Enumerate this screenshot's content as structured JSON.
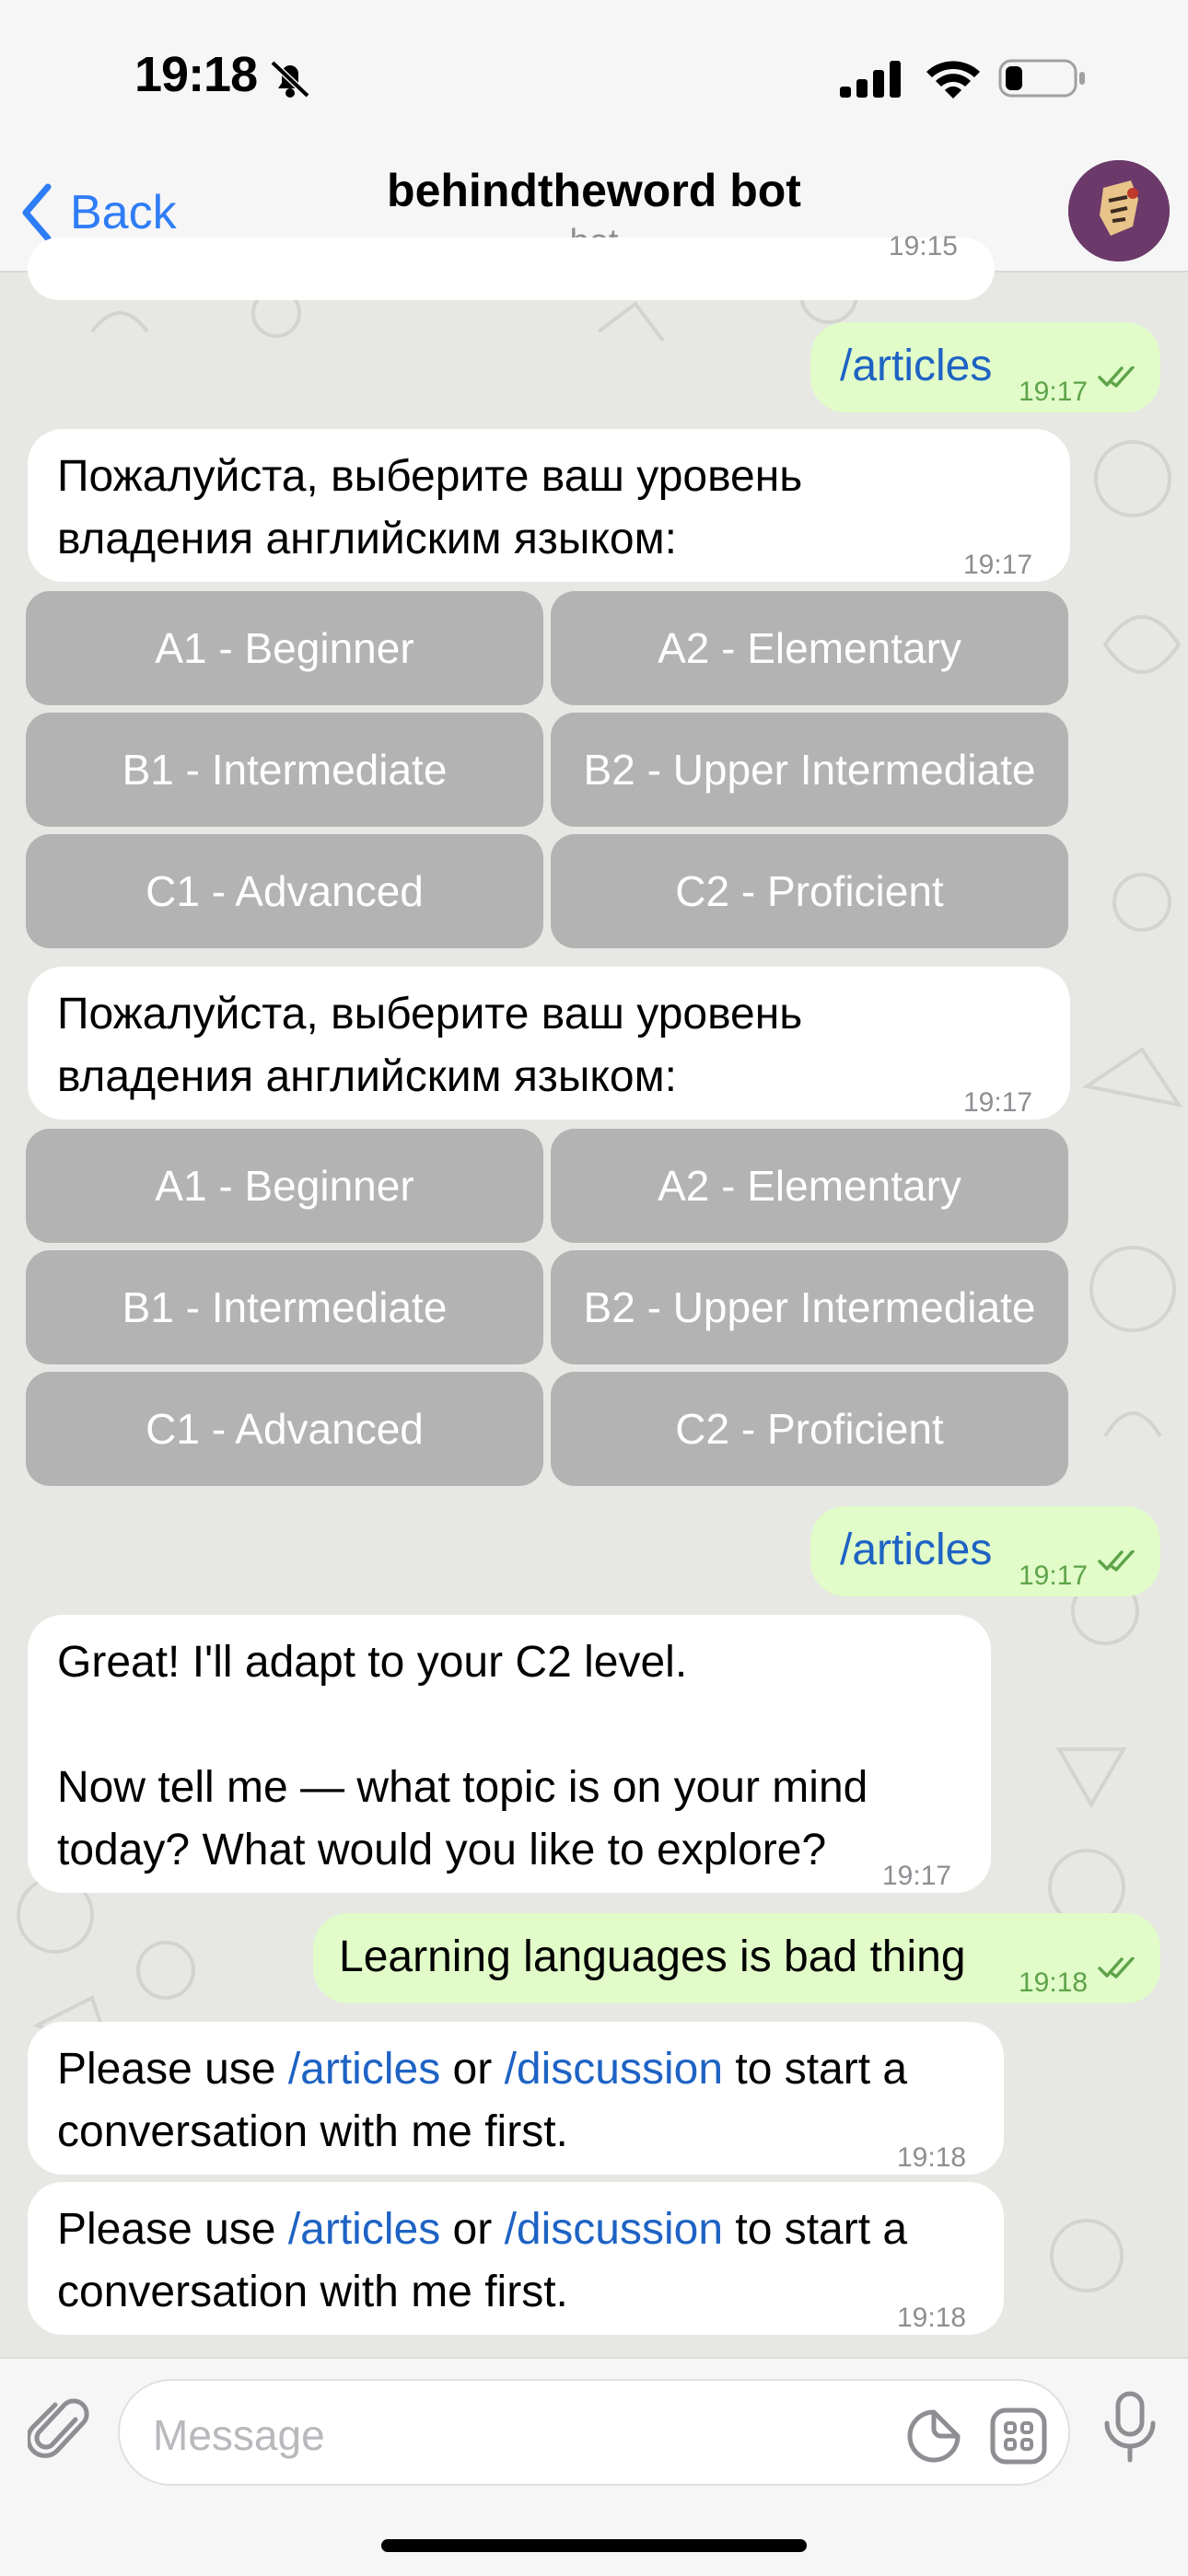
{
  "status_bar": {
    "time": "19:18"
  },
  "header": {
    "back_label": "Back",
    "title": "behindtheword bot",
    "subtitle": "bot"
  },
  "chat": {
    "partial_time": "19:15",
    "msg1": {
      "text": "/articles",
      "time": "19:17"
    },
    "msg2": {
      "line1": "Пожалуйста, выберите ваш уровень",
      "line2": "владения английским языком:",
      "time": "19:17"
    },
    "keyboard1": [
      "A1 - Beginner",
      "A2 - Elementary",
      "B1 - Intermediate",
      "B2 - Upper Intermediate",
      "C1 - Advanced",
      "C2 - Proficient"
    ],
    "msg3": {
      "line1": "Пожалуйста, выберите ваш уровень",
      "line2": "владения английским языком:",
      "time": "19:17"
    },
    "keyboard2": [
      "A1 - Beginner",
      "A2 - Elementary",
      "B1 - Intermediate",
      "B2 - Upper Intermediate",
      "C1 - Advanced",
      "C2 - Proficient"
    ],
    "msg4": {
      "text": "/articles",
      "time": "19:17"
    },
    "msg5": {
      "line1": "Great! I'll adapt to your C2 level.",
      "line2": "Now tell me — what topic is on your mind",
      "line3": "today? What would you like to explore?",
      "time": "19:17"
    },
    "msg6": {
      "text": "Learning languages is bad thing",
      "time": "19:18"
    },
    "msg7": {
      "pre": "Please use ",
      "cmd1": "/articles",
      "mid": " or ",
      "cmd2": "/discussion",
      "post": " to start a",
      "line2": "conversation with me first.",
      "time": "19:18"
    },
    "msg8": {
      "pre": "Please use ",
      "cmd1": "/articles",
      "mid": " or ",
      "cmd2": "/discussion",
      "post": " to start a",
      "line2": "conversation with me first.",
      "time": "19:18"
    }
  },
  "input": {
    "placeholder": "Message"
  },
  "colors": {
    "accent": "#2f7df6",
    "outgoing_bubble": "#e1fcc8",
    "incoming_bubble": "#ffffff",
    "keyboard_button": "#b3b3b3",
    "command_link": "#1e63c4"
  }
}
